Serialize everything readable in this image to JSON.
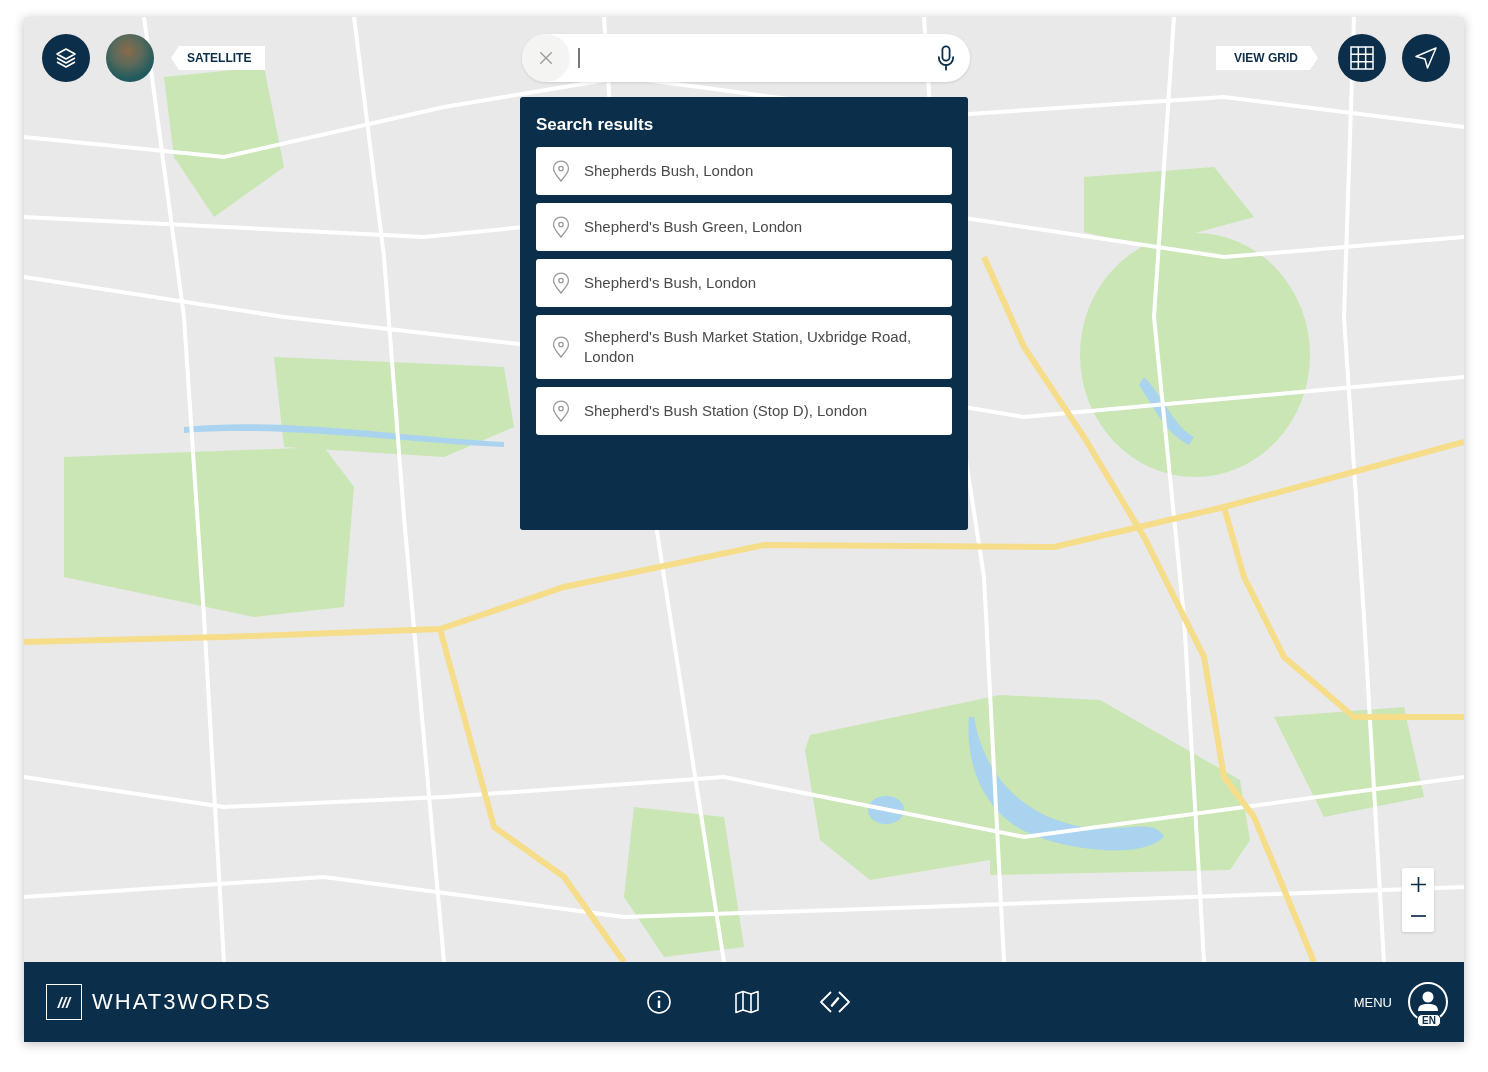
{
  "map_controls": {
    "satellite_label": "SATELLITE",
    "view_grid_label": "VIEW GRID"
  },
  "search_results": {
    "title": "Search results",
    "results": [
      "Shepherds Bush, London",
      "Shepherd's Bush Green, London",
      "Shepherd's Bush, London",
      "Shepherd's Bush Market Station, Uxbridge Road, London",
      "Shepherd's Bush Station (Stop D), London"
    ]
  },
  "footer": {
    "logo_mark": "///",
    "wordmark": "WHAT3WORDS",
    "menu_label": "MENU",
    "language_badge": "EN"
  }
}
